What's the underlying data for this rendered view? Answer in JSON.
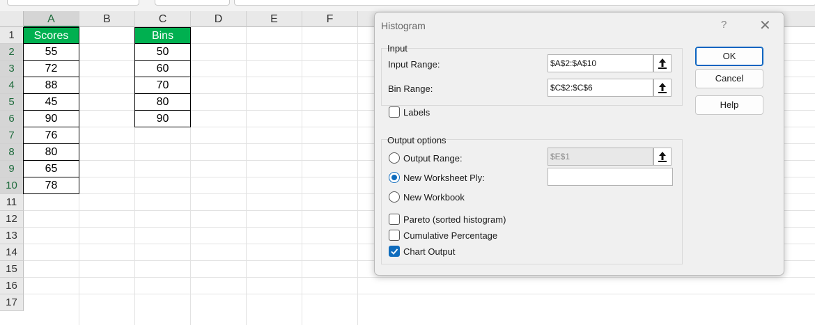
{
  "sheet": {
    "columns": [
      "A",
      "B",
      "C",
      "D",
      "E",
      "F"
    ],
    "rows": [
      "1",
      "2",
      "3",
      "4",
      "5",
      "6",
      "7",
      "8",
      "9",
      "10",
      "11",
      "12",
      "13",
      "14",
      "15",
      "16",
      "17"
    ],
    "scores_header": "Scores",
    "scores": [
      "55",
      "72",
      "88",
      "45",
      "90",
      "76",
      "80",
      "65",
      "78"
    ],
    "bins_header": "Bins",
    "bins": [
      "50",
      "60",
      "70",
      "80",
      "90"
    ]
  },
  "dialog": {
    "title": "Histogram",
    "help_glyph": "?",
    "close_glyph": "✕",
    "input_group": "Input",
    "input_range_label": "Input Range:",
    "input_range_value": "$A$2:$A$10",
    "bin_range_label": "Bin Range:",
    "bin_range_value": "$C$2:$C$6",
    "labels_label": "Labels",
    "labels_checked": false,
    "output_group": "Output options",
    "output_range_label": "Output Range:",
    "output_range_value": "$E$1",
    "new_ply_label": "New Worksheet Ply:",
    "new_ply_value": "",
    "new_workbook_label": "New Workbook",
    "selected_output": "new_worksheet_ply",
    "pareto_label": "Pareto (sorted histogram)",
    "pareto_checked": false,
    "cumulative_label": "Cumulative Percentage",
    "cumulative_checked": false,
    "chart_label": "Chart Output",
    "chart_checked": true,
    "ok": "OK",
    "cancel": "Cancel",
    "help": "Help",
    "accent_color": "#0f6cbd",
    "header_fill_color": "#00b050",
    "ref_icon": "collapse-dialog-arrow-icon"
  }
}
